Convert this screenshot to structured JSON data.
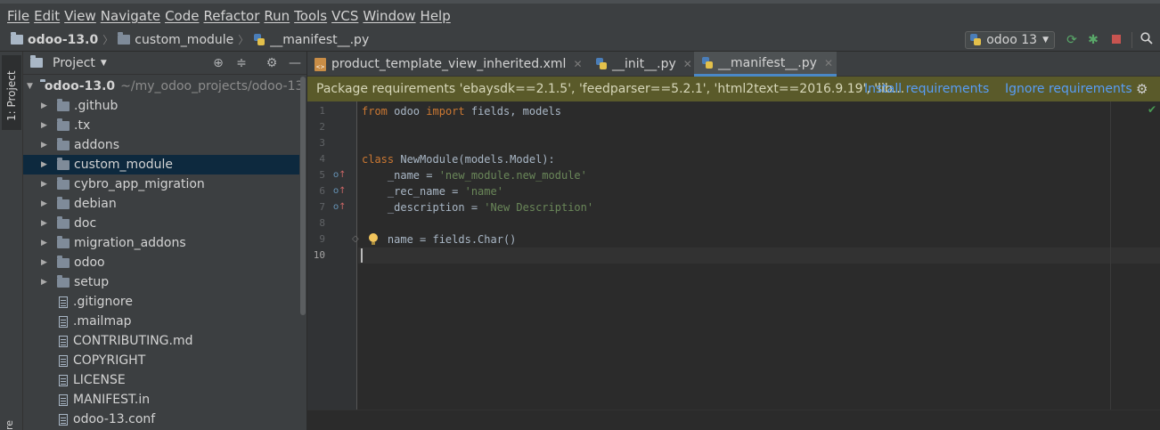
{
  "menu": [
    {
      "label": "File",
      "u": true
    },
    {
      "label": "Edit",
      "u": true
    },
    {
      "label": "View",
      "u": true
    },
    {
      "label": "Navigate",
      "u": true
    },
    {
      "label": "Code",
      "u": true
    },
    {
      "label": "Refactor",
      "u": true
    },
    {
      "label": "Run",
      "u": true
    },
    {
      "label": "Tools",
      "u": true
    },
    {
      "label": "VCS",
      "u": true
    },
    {
      "label": "Window",
      "u": true
    },
    {
      "label": "Help",
      "u": true
    }
  ],
  "breadcrumb": {
    "root": "odoo-13.0",
    "folder": "custom_module",
    "file": "__manifest__.py"
  },
  "run_config": {
    "label": "odoo 13"
  },
  "sidebar": {
    "tab_project": "1: Project",
    "tab_bottom": "re"
  },
  "project": {
    "title": "Project",
    "root": {
      "name": "odoo-13.0",
      "path": "~/my_odoo_projects/odoo-13"
    },
    "folders": [
      "github",
      "tx",
      "addons",
      "custom_module",
      "cybro_app_migration",
      "debian",
      "doc",
      "migration_addons",
      "odoo",
      "setup"
    ],
    "folder_prefix": [
      ".",
      ".",
      "",
      "",
      "",
      "",
      "",
      "",
      "",
      ""
    ],
    "files": [
      ".gitignore",
      ".mailmap",
      "CONTRIBUTING.md",
      "COPYRIGHT",
      "LICENSE",
      "MANIFEST.in",
      "odoo-13.conf"
    ]
  },
  "tabs": [
    {
      "label": "product_template_view_inherited.xml",
      "type": "xml"
    },
    {
      "label": "__init__.py",
      "type": "py"
    },
    {
      "label": "__manifest__.py",
      "type": "py",
      "active": true
    }
  ],
  "banner": {
    "text": "Package requirements 'ebaysdk==2.1.5', 'feedparser==5.2.1', 'html2text==2016.9.19', 'lib...",
    "install": "Install requirements",
    "ignore": "Ignore requirements"
  },
  "code": {
    "line_numbers": [
      "1",
      "2",
      "3",
      "4",
      "5",
      "6",
      "7",
      "8",
      "9",
      "10"
    ],
    "l1_kw1": "from",
    "l1_mod": " odoo ",
    "l1_kw2": "import",
    "l1_rest": " fields, models",
    "l4_kw": "class",
    "l4_rest": " NewModule(models.Model):",
    "l5_key": "    _name = ",
    "l5_val": "'new_module.new_module'",
    "l6_key": "    _rec_name = ",
    "l6_val": "'name'",
    "l7_key": "    _description = ",
    "l7_val": "'New Description'",
    "l9": "    name = fields.Char()"
  }
}
